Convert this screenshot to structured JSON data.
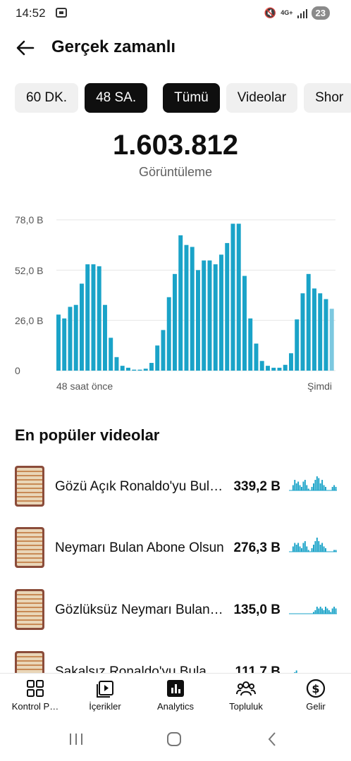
{
  "status_bar": {
    "time": "14:52",
    "network": "4G+",
    "battery": "23"
  },
  "header": {
    "title": "Gerçek zamanlı"
  },
  "chips": [
    {
      "label": "60 DK.",
      "active": false
    },
    {
      "label": "48 SA.",
      "active": true
    },
    {
      "label": "Tümü",
      "active": true
    },
    {
      "label": "Videolar",
      "active": false
    },
    {
      "label": "Shor",
      "active": false
    }
  ],
  "metric": {
    "value": "1.603.812",
    "label": "Görüntüleme"
  },
  "chart_data": {
    "type": "bar",
    "ylim": [
      0,
      78000
    ],
    "yticks": [
      "78,0 B",
      "52,0 B",
      "26,0 B",
      "0"
    ],
    "ytick_values": [
      78000,
      52000,
      26000,
      0
    ],
    "x_start_label": "48 saat önce",
    "x_end_label": "Şimdi",
    "grid": true,
    "values": [
      29000,
      27000,
      33000,
      34000,
      45000,
      55000,
      55000,
      54000,
      34000,
      17000,
      7000,
      2500,
      1500,
      500,
      500,
      1000,
      4000,
      13000,
      21000,
      38000,
      50000,
      70000,
      65000,
      64000,
      52000,
      57000,
      57000,
      55000,
      60000,
      66000,
      76000,
      76000,
      49000,
      27000,
      14000,
      5000,
      2500,
      1500,
      1500,
      3000,
      9000,
      26500,
      40000,
      50000,
      42500,
      40000,
      37000,
      32000
    ],
    "bar_color": "#1aa3c8",
    "last_bar_color": "#7cc8e0"
  },
  "top_videos": {
    "title": "En popüler videolar",
    "items": [
      {
        "title": "Gözü Açık Ronaldo'yu Bulan Abone Olsun",
        "views": "339,2 B",
        "spark": [
          0,
          0,
          3,
          6,
          4,
          5,
          3,
          2,
          5,
          6,
          3,
          1,
          0,
          2,
          4,
          6,
          8,
          7,
          4,
          6,
          3,
          2,
          0,
          0,
          0,
          2,
          3,
          2
        ]
      },
      {
        "title": "Neymarı Bulan Abone Olsun",
        "views": "276,3 B",
        "spark": [
          0,
          0,
          3,
          5,
          4,
          5,
          3,
          2,
          5,
          6,
          3,
          1,
          0,
          2,
          4,
          6,
          8,
          6,
          4,
          5,
          3,
          2,
          0,
          0,
          0,
          0,
          1,
          1
        ]
      },
      {
        "title": "Gözlüksüz Neymarı Bulan Abone Olsun",
        "views": "135,0 B",
        "spark": [
          0,
          0,
          0,
          0,
          0,
          0,
          0,
          0,
          0,
          0,
          0,
          0,
          0,
          0,
          1,
          2,
          4,
          3,
          4,
          3,
          2,
          4,
          3,
          2,
          1,
          3,
          4,
          3
        ]
      },
      {
        "title": "Sakalsız Ronaldo'yu Bulan Abone Olsun",
        "views": "111,7 B",
        "spark": [
          0,
          0,
          0,
          2,
          3,
          0,
          0,
          0,
          0,
          0,
          0,
          0,
          0,
          0,
          0,
          0,
          0,
          0,
          0,
          0,
          0,
          0,
          0,
          0,
          0,
          0,
          0,
          0
        ]
      }
    ]
  },
  "bottom_nav": [
    {
      "label": "Kontrol P…",
      "icon": "dashboard-icon"
    },
    {
      "label": "İçerikler",
      "icon": "content-icon"
    },
    {
      "label": "Analytics",
      "icon": "analytics-icon"
    },
    {
      "label": "Topluluk",
      "icon": "community-icon"
    },
    {
      "label": "Gelir",
      "icon": "earn-icon"
    }
  ],
  "colors": {
    "accent": "#1aa3c8",
    "text": "#0f0f0f",
    "muted": "#606060"
  }
}
